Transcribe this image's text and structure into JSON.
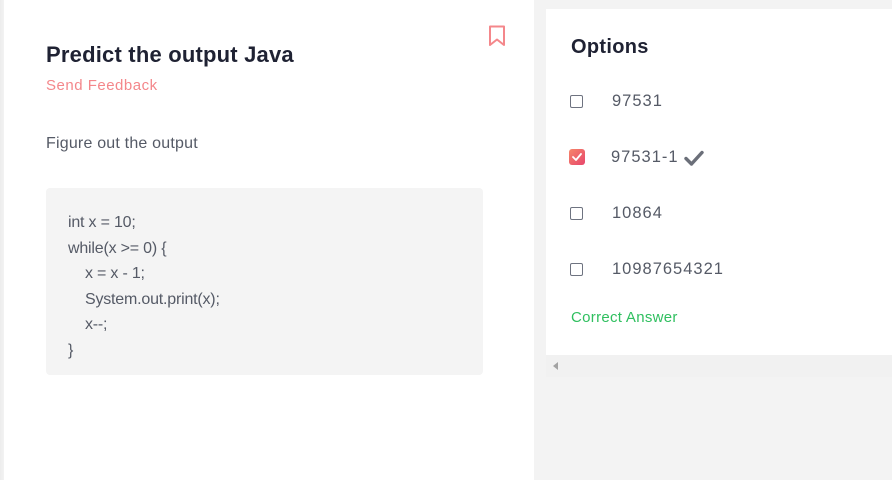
{
  "question": {
    "title": "Predict the output Java",
    "send_feedback": "Send Feedback",
    "description": "Figure out the output",
    "code_lines": [
      "int x = 10;",
      "while(x >= 0) {",
      "    x = x - 1;",
      "    System.out.print(x);",
      "    x--;",
      "}"
    ]
  },
  "options": {
    "title": "Options",
    "items": [
      {
        "label": "97531",
        "checked": false
      },
      {
        "label": "97531-1",
        "checked": true
      },
      {
        "label": "10864",
        "checked": false
      },
      {
        "label": "10987654321",
        "checked": false
      }
    ],
    "correct_answer_label": "Correct Answer"
  },
  "colors": {
    "accent": "#f4878b",
    "correct": "#2fbf5f",
    "checkbox_gradient_start": "#f6866a",
    "checkbox_gradient_end": "#e7466c"
  }
}
